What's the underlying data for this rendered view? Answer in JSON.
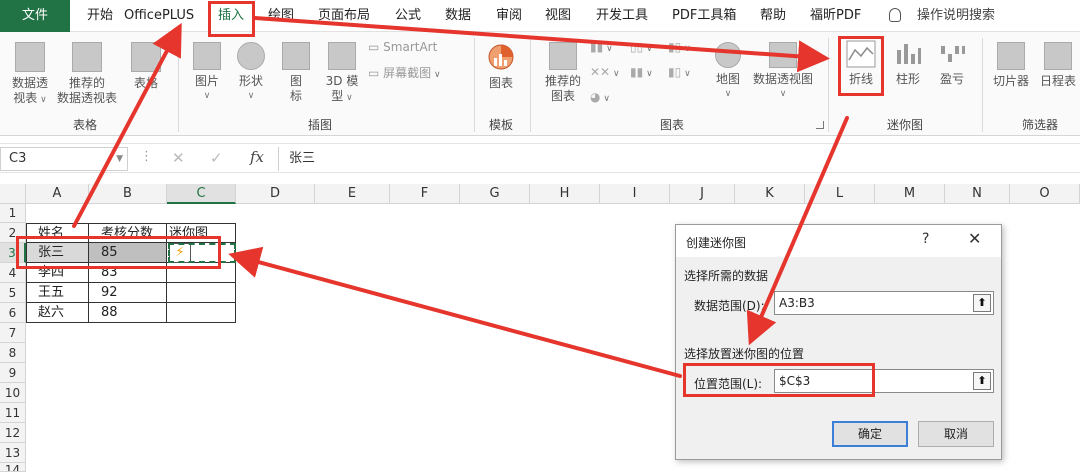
{
  "menubar": {
    "file": "文件",
    "tabs": [
      "开始",
      "OfficePLUS",
      "插入",
      "绘图",
      "页面布局",
      "公式",
      "数据",
      "审阅",
      "视图",
      "开发工具",
      "PDF工具箱",
      "帮助",
      "福昕PDF"
    ],
    "active_tab": "插入",
    "search_label": "操作说明搜索"
  },
  "ribbon": {
    "groups": {
      "tables": {
        "label": "表格",
        "pivot_l1": "数据透",
        "pivot_l2": "视表",
        "rec_pivot_l1": "推荐的",
        "rec_pivot_l2": "数据透视表",
        "table": "表格"
      },
      "illustrations": {
        "label": "插图",
        "picture": "图片",
        "shape": "形状",
        "icon_l1": "图",
        "icon_l2": "标",
        "model_l1": "3D 模",
        "model_l2": "型",
        "smartart": "SmartArt",
        "screenshot": "屏幕截图"
      },
      "templates": {
        "label": "模板",
        "chart": "图表"
      },
      "charts": {
        "label": "图表",
        "rec_chart_l1": "推荐的",
        "rec_chart_l2": "图表",
        "map": "地图",
        "pivot_chart": "数据透视图"
      },
      "sparklines": {
        "label": "迷你图",
        "line": "折线",
        "column": "柱形",
        "winloss": "盈亏"
      },
      "filters": {
        "label": "筛选器",
        "slicer": "切片器",
        "timeline": "日程表"
      }
    }
  },
  "formulabar": {
    "namebox": "C3",
    "content": "张三"
  },
  "grid": {
    "columns": [
      "A",
      "B",
      "C",
      "D",
      "E",
      "F",
      "G",
      "H",
      "I",
      "J",
      "K",
      "L",
      "M",
      "N",
      "O"
    ],
    "rows": [
      "1",
      "2",
      "3",
      "4",
      "5",
      "6",
      "7",
      "8",
      "9",
      "10",
      "11",
      "12",
      "13",
      "14"
    ],
    "headers": [
      "姓名",
      "考核分数",
      "迷你图"
    ],
    "data": [
      [
        "张三",
        "85"
      ],
      [
        "李四",
        "83"
      ],
      [
        "王五",
        "92"
      ],
      [
        "赵六",
        "88"
      ]
    ]
  },
  "dialog": {
    "title": "创建迷你图",
    "help": "?",
    "close": "✕",
    "section_data": "选择所需的数据",
    "data_range_label": "数据范围(D):",
    "data_range_value": "A3:B3",
    "section_location": "选择放置迷你图的位置",
    "location_label": "位置范围(L):",
    "location_value": "$C$3",
    "ok": "确定",
    "cancel": "取消"
  },
  "colors": {
    "excel_green": "#217346",
    "annotation_red": "#e5352d"
  }
}
